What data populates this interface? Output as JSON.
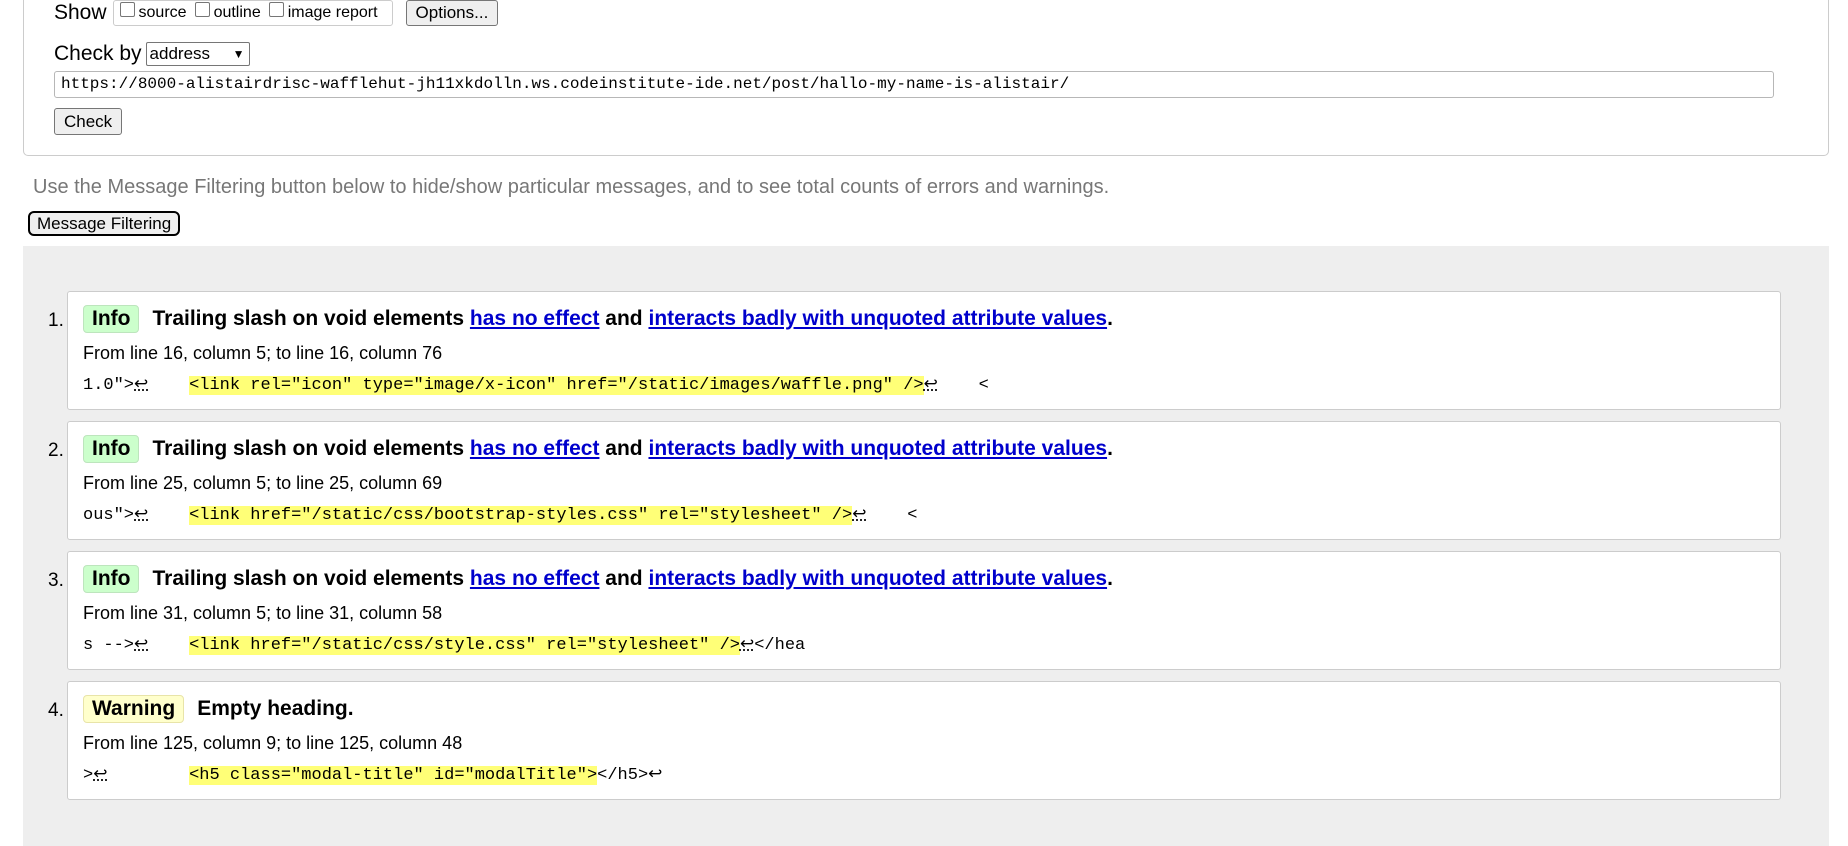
{
  "form": {
    "show_label": "Show",
    "show_options": [
      {
        "label": "source",
        "checked": false
      },
      {
        "label": "outline",
        "checked": false
      },
      {
        "label": "image report",
        "checked": false
      }
    ],
    "options_button": "Options...",
    "check_by_label": "Check by",
    "check_by_value": "address",
    "url_value": "https://8000-alistairdrisc-wafflehut-jh11xkdolln.ws.codeinstitute-ide.net/post/hallo-my-name-is-alistair/",
    "check_button": "Check"
  },
  "filter_hint": "Use the Message Filtering button below to hide/show particular messages, and to see total counts of errors and warnings.",
  "filter_button": "Message Filtering",
  "messages": [
    {
      "num": "1.",
      "type": "Info",
      "title": "Trailing slash on void elements",
      "link1": "has no effect",
      "mid": "and",
      "link2": "interacts badly with unquoted attribute values",
      "end": ".",
      "location": "From line 16, column 5; to line 16, column 76",
      "pre": "1.0\">",
      "pre_lf": "↩",
      "gap": "    ",
      "highlight": "<link rel=\"icon\" type=\"image/x-icon\" href=\"/static/images/waffle.png\" />",
      "post_lf": "↩",
      "post": "    <"
    },
    {
      "num": "2.",
      "type": "Info",
      "title": "Trailing slash on void elements",
      "link1": "has no effect",
      "mid": "and",
      "link2": "interacts badly with unquoted attribute values",
      "end": ".",
      "location": "From line 25, column 5; to line 25, column 69",
      "pre": "ous\">",
      "pre_lf": "↩",
      "gap": "    ",
      "highlight": "<link href=\"/static/css/bootstrap-styles.css\" rel=\"stylesheet\" />",
      "post_lf": "↩",
      "post": "    <"
    },
    {
      "num": "3.",
      "type": "Info",
      "title": "Trailing slash on void elements",
      "link1": "has no effect",
      "mid": "and",
      "link2": "interacts badly with unquoted attribute values",
      "end": ".",
      "location": "From line 31, column 5; to line 31, column 58",
      "pre": "s -->",
      "pre_lf": "↩",
      "gap": "    ",
      "highlight": "<link href=\"/static/css/style.css\" rel=\"stylesheet\" />",
      "post_lf": "↩",
      "post": "</hea"
    },
    {
      "num": "4.",
      "type": "Warning",
      "title": "Empty heading.",
      "link1": "",
      "mid": "",
      "link2": "",
      "end": "",
      "location": "From line 125, column 9; to line 125, column 48",
      "pre": ">",
      "pre_lf": "↩",
      "gap": "        ",
      "highlight": "<h5 class=\"modal-title\" id=\"modalTitle\">",
      "post_lf": "",
      "post": "</h5>↩"
    }
  ]
}
